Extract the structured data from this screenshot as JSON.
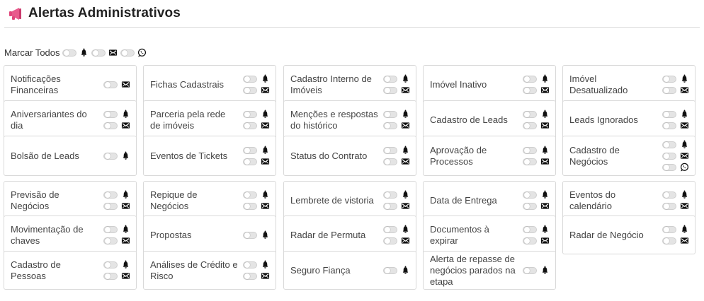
{
  "header": {
    "title": "Alertas Administrativos",
    "icon": "megaphone-icon",
    "icon_color": "#e0457b"
  },
  "mark_all": {
    "label": "Marcar Todos",
    "channels": [
      "bell-icon",
      "email-icon",
      "whatsapp-icon"
    ]
  },
  "cards": [
    {
      "label": "Notificações Financeiras",
      "channels": [
        "email"
      ]
    },
    {
      "label": "Fichas Cadastrais",
      "channels": [
        "bell",
        "email"
      ]
    },
    {
      "label": "Cadastro Interno de Imóveis",
      "channels": [
        "bell",
        "email"
      ]
    },
    {
      "label": "Imóvel Inativo",
      "channels": [
        "bell",
        "email"
      ]
    },
    {
      "label": "Imóvel Desatualizado",
      "channels": [
        "bell",
        "email"
      ]
    },
    {
      "label": "Aniversariantes do dia",
      "channels": [
        "bell",
        "email"
      ]
    },
    {
      "label": "Parceria pela rede de imóveis",
      "channels": [
        "bell",
        "email"
      ]
    },
    {
      "label": "Menções e respostas do histórico",
      "channels": [
        "bell",
        "email"
      ]
    },
    {
      "label": "Cadastro de Leads",
      "channels": [
        "bell",
        "email"
      ]
    },
    {
      "label": "Leads Ignorados",
      "channels": [
        "bell",
        "email"
      ]
    },
    {
      "label": "Bolsão de Leads",
      "channels": [
        "bell"
      ]
    },
    {
      "label": "Eventos de Tickets",
      "channels": [
        "bell",
        "email"
      ]
    },
    {
      "label": "Status do Contrato",
      "channels": [
        "bell",
        "email"
      ]
    },
    {
      "label": "Aprovação de Processos",
      "channels": [
        "bell",
        "email"
      ]
    },
    {
      "label": "Cadastro de Negócios",
      "channels": [
        "bell",
        "email",
        "whatsapp"
      ]
    },
    {
      "label": "Previsão de Negócios",
      "channels": [
        "bell",
        "email"
      ]
    },
    {
      "label": "Repique de Negócios",
      "channels": [
        "bell",
        "email"
      ]
    },
    {
      "label": "Lembrete de vistoria",
      "channels": [
        "bell",
        "email"
      ]
    },
    {
      "label": "Data de Entrega",
      "channels": [
        "bell",
        "email"
      ]
    },
    {
      "label": "Eventos do calendário",
      "channels": [
        "bell",
        "email"
      ]
    },
    {
      "label": "Movimentação de chaves",
      "channels": [
        "bell",
        "email"
      ]
    },
    {
      "label": "Propostas",
      "channels": [
        "bell"
      ]
    },
    {
      "label": "Radar de Permuta",
      "channels": [
        "bell",
        "email"
      ]
    },
    {
      "label": "Documentos à expirar",
      "channels": [
        "bell",
        "email"
      ]
    },
    {
      "label": "Radar de Negócio",
      "channels": [
        "bell",
        "email"
      ]
    },
    {
      "label": "Cadastro de Pessoas",
      "channels": [
        "bell",
        "email"
      ]
    },
    {
      "label": "Análises de Crédito e Risco",
      "channels": [
        "bell",
        "email"
      ]
    },
    {
      "label": "Seguro Fiança",
      "channels": [
        "bell"
      ]
    },
    {
      "label": "Alerta de repasse de negócios parados na etapa",
      "channels": [
        "bell"
      ]
    }
  ]
}
